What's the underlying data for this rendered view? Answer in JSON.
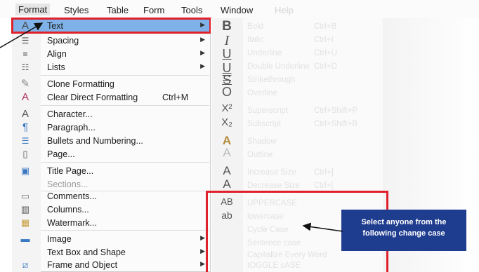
{
  "menubar": {
    "items": [
      "Format",
      "Styles",
      "Table",
      "Form",
      "Tools",
      "Window",
      "Help"
    ]
  },
  "format_menu": {
    "items": [
      {
        "label": "Text",
        "icon": "text-icon",
        "submenu": true
      },
      {
        "label": "Spacing",
        "icon": "spacing-icon",
        "submenu": true
      },
      {
        "label": "Align",
        "icon": "align-icon",
        "submenu": true
      },
      {
        "label": "Lists",
        "icon": "lists-icon",
        "submenu": true
      },
      {
        "label": "Clone Formatting",
        "icon": "clone-formatting-icon"
      },
      {
        "label": "Clear Direct Formatting",
        "shortcut": "Ctrl+M",
        "icon": "clear-formatting-icon"
      },
      {
        "label": "Character...",
        "icon": "character-icon"
      },
      {
        "label": "Paragraph...",
        "icon": "paragraph-icon"
      },
      {
        "label": "Bullets and Numbering...",
        "icon": "bullets-icon"
      },
      {
        "label": "Page...",
        "icon": "page-icon"
      },
      {
        "label": "Title Page...",
        "icon": "title-page-icon"
      },
      {
        "label": "Sections...",
        "icon": "sections-icon",
        "disabled": true
      },
      {
        "label": "Comments...",
        "icon": "comments-icon"
      },
      {
        "label": "Columns...",
        "icon": "columns-icon"
      },
      {
        "label": "Watermark...",
        "icon": "watermark-icon"
      },
      {
        "label": "Image",
        "icon": "image-icon",
        "submenu": true
      },
      {
        "label": "Text Box and Shape",
        "icon": "text-box-icon",
        "submenu": true
      },
      {
        "label": "Frame and Object",
        "icon": "frame-icon",
        "submenu": true
      }
    ]
  },
  "text_submenu": {
    "items": [
      {
        "label": "Bold",
        "shortcut": "Ctrl+B"
      },
      {
        "label": "Italic",
        "shortcut": "Ctrl+I"
      },
      {
        "label": "Underline",
        "shortcut": "Ctrl+U"
      },
      {
        "label": "Double Underline",
        "shortcut": "Ctrl+D"
      },
      {
        "label": "Strikethrough",
        "shortcut": ""
      },
      {
        "label": "Overline",
        "shortcut": ""
      },
      {
        "label": "Superscript",
        "shortcut": "Ctrl+Shift+P"
      },
      {
        "label": "Subscript",
        "shortcut": "Ctrl+Shift+B"
      },
      {
        "label": "Shadow",
        "shortcut": ""
      },
      {
        "label": "Outline",
        "shortcut": ""
      },
      {
        "label": "Increase Size",
        "shortcut": "Ctrl+]"
      },
      {
        "label": "Decrease Size",
        "shortcut": "Ctrl+["
      },
      {
        "label": "UPPERCASE",
        "shortcut": ""
      },
      {
        "label": "lowercase",
        "shortcut": ""
      },
      {
        "label": "Cycle Case",
        "shortcut": ""
      },
      {
        "label": "Sentence case",
        "shortcut": ""
      },
      {
        "label": "Capitalize Every Word",
        "shortcut": ""
      },
      {
        "label": "tOGGLE cASE",
        "shortcut": ""
      }
    ],
    "icon_glyphs": [
      "B",
      "I",
      "U",
      "U",
      "S",
      "O",
      "X²",
      "X₂",
      "A",
      "A",
      "A",
      "A",
      "AB",
      "ab"
    ]
  },
  "callout": {
    "line1": "Select anyone from the",
    "line2": "following change case"
  },
  "colors": {
    "highlight": "#7fb2e8",
    "annotation_red": "#e0202a",
    "callout_bg": "#1f3d8f"
  }
}
